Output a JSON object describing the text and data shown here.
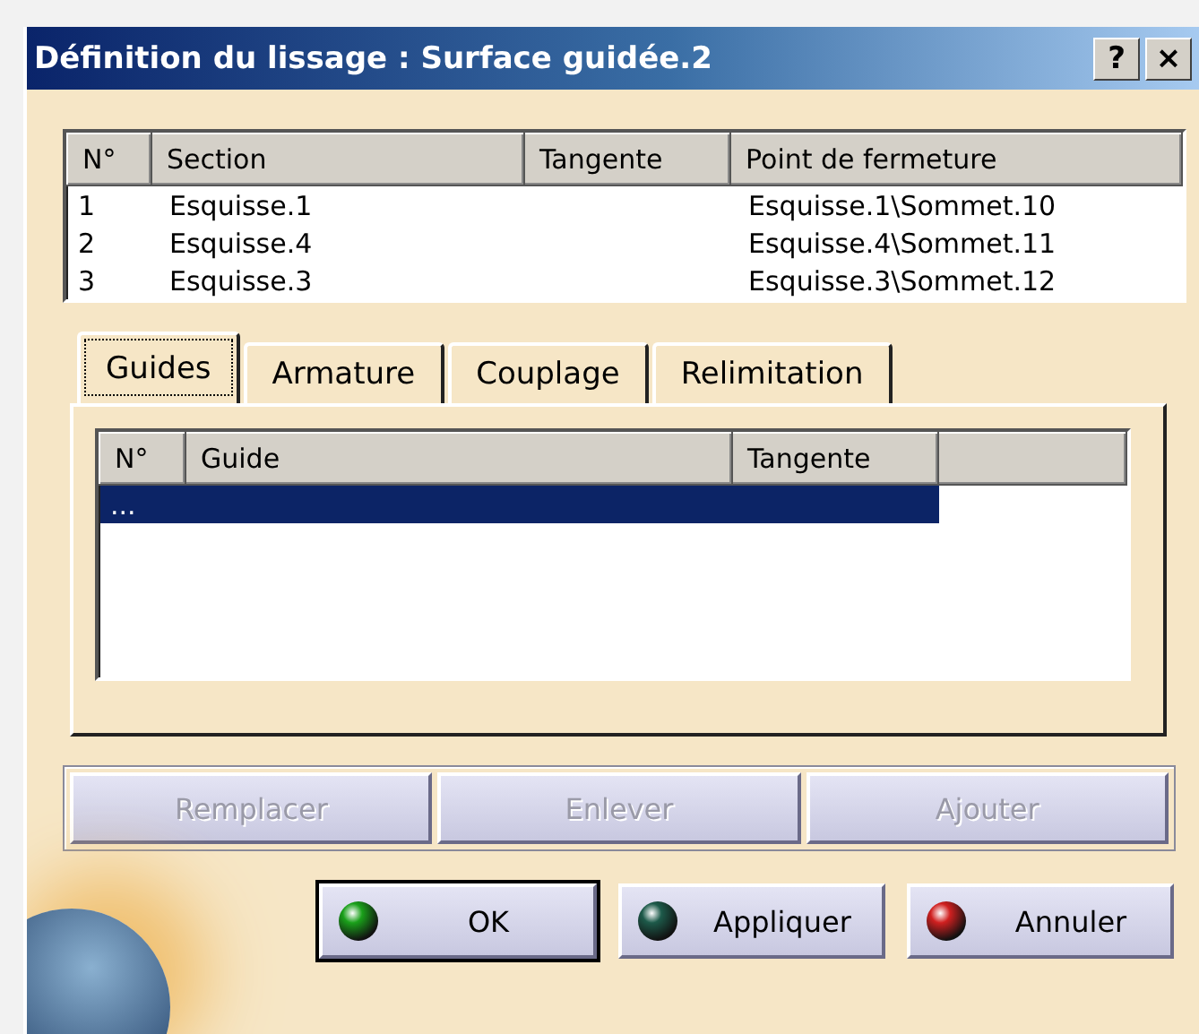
{
  "window": {
    "title": "Définition du lissage : Surface guidée.2",
    "help": "?",
    "close": "×"
  },
  "sections": {
    "columns": [
      "N°",
      "Section",
      "Tangente",
      "Point de fermeture"
    ],
    "rows": [
      {
        "cells": [
          "1",
          "Esquisse.1",
          "",
          "Esquisse.1\\Sommet.10"
        ]
      },
      {
        "cells": [
          "2",
          "Esquisse.4",
          "",
          "Esquisse.4\\Sommet.11"
        ]
      },
      {
        "cells": [
          "3",
          "Esquisse.3",
          "",
          "Esquisse.3\\Sommet.12"
        ]
      }
    ]
  },
  "tabs": [
    {
      "label": "Guides",
      "selected": true
    },
    {
      "label": "Armature",
      "selected": false
    },
    {
      "label": "Couplage",
      "selected": false
    },
    {
      "label": "Relimitation",
      "selected": false
    }
  ],
  "guides": {
    "columns": [
      "N°",
      "Guide",
      "Tangente"
    ],
    "rows": [
      {
        "cells": [
          "...",
          "",
          ""
        ],
        "selected": true
      }
    ]
  },
  "actions": [
    {
      "label": "Remplacer",
      "disabled": true
    },
    {
      "label": "Enlever",
      "disabled": true
    },
    {
      "label": "Ajouter",
      "disabled": true
    }
  ],
  "buttons": [
    {
      "label": "OK",
      "kind": "ok",
      "default": true
    },
    {
      "label": "Appliquer",
      "kind": "apply",
      "default": false
    },
    {
      "label": "Annuler",
      "kind": "cancel",
      "default": false
    }
  ]
}
